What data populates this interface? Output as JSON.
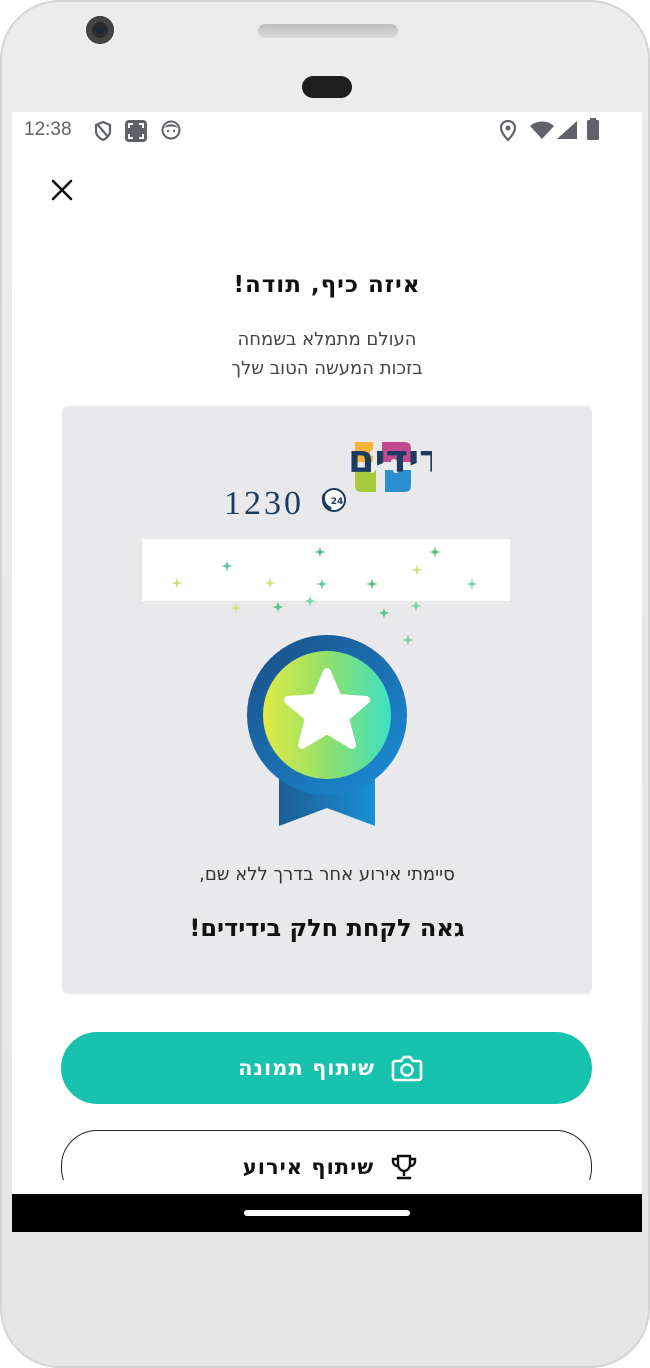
{
  "status_bar": {
    "time": "12:38"
  },
  "header": {
    "title": "איזה כיף, תודה!",
    "subtitle_line1": "העולם מתמלא בשמחה",
    "subtitle_line2": "בזכות המעשה הטוב שלך"
  },
  "logo": {
    "name": "ידידים",
    "number": "1230",
    "badge": "24"
  },
  "card": {
    "line1": "סיימתי אירוע אחר בדרך ללא שם,",
    "line2": "גאה לקחת חלק בידידים!"
  },
  "actions": {
    "share_photo_label": "שיתוף תמונה",
    "share_event_label": "שיתוף אירוע"
  },
  "colors": {
    "primary": "#18c3ad",
    "logo_navy": "#1b3b5f"
  }
}
